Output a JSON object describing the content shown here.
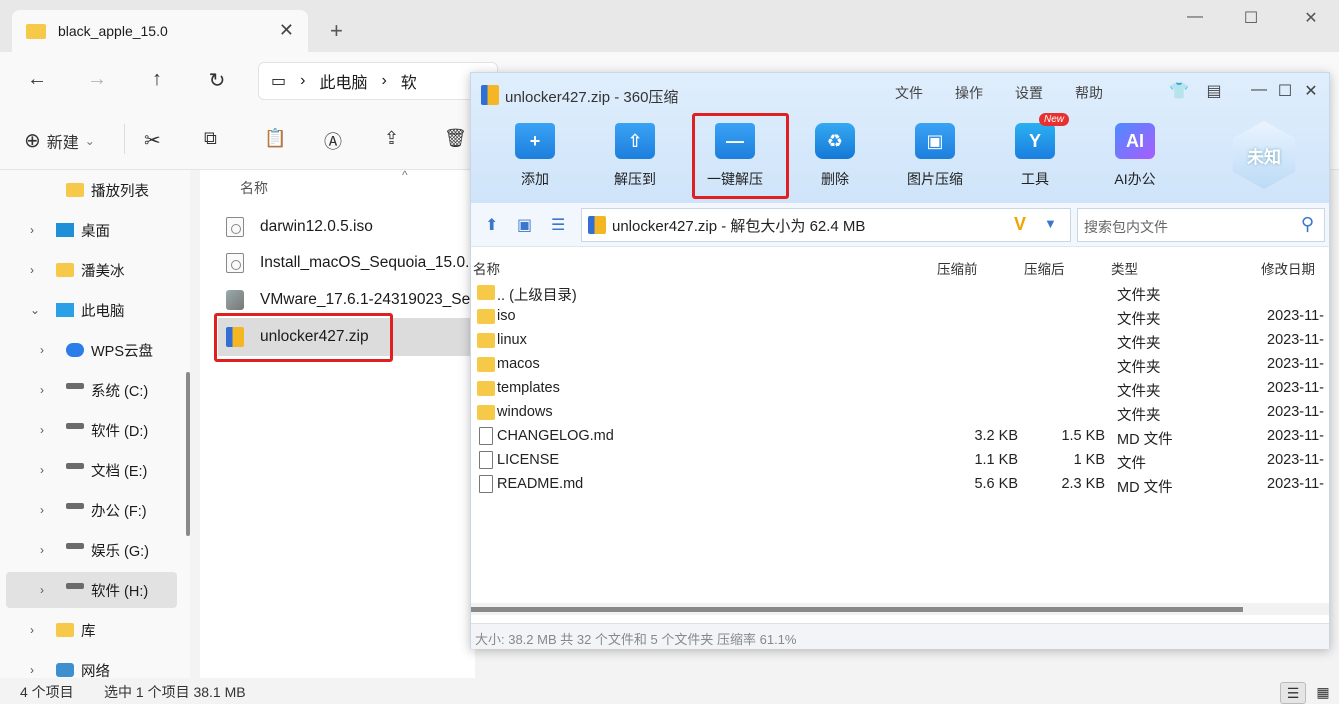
{
  "explorer": {
    "tab_title": "black_apple_15.0",
    "tab_close": "✕",
    "new_tab": "+",
    "window_controls": {
      "minimize": "—",
      "maximize": "☐",
      "close": "✕"
    },
    "nav": {
      "back": "←",
      "forward": "→",
      "up": "↑",
      "refresh": "↻"
    },
    "breadcrumb": [
      "此电脑",
      "软"
    ],
    "commandbar": {
      "new_label": "新建",
      "new_caret": "⌄"
    },
    "sidebar": [
      {
        "label": "播放列表",
        "kind": "folder",
        "chevron": ""
      },
      {
        "label": "桌面",
        "kind": "desktop",
        "chevron": "›"
      },
      {
        "label": "潘美冰",
        "kind": "folder",
        "chevron": "›"
      },
      {
        "label": "此电脑",
        "kind": "pc",
        "chevron": "⌄"
      },
      {
        "label": "WPS云盘",
        "kind": "cloud",
        "chevron": "›"
      },
      {
        "label": "系统 (C:)",
        "kind": "drive",
        "chevron": "›"
      },
      {
        "label": "软件 (D:)",
        "kind": "drive",
        "chevron": "›"
      },
      {
        "label": "文档 (E:)",
        "kind": "drive",
        "chevron": "›"
      },
      {
        "label": "办公 (F:)",
        "kind": "drive",
        "chevron": "›"
      },
      {
        "label": "娱乐 (G:)",
        "kind": "drive",
        "chevron": "›"
      },
      {
        "label": "软件 (H:)",
        "kind": "drive",
        "chevron": "›",
        "selected": true
      },
      {
        "label": "库",
        "kind": "folder",
        "chevron": "›"
      },
      {
        "label": "网络",
        "kind": "network",
        "chevron": "›"
      }
    ],
    "files_header": "名称",
    "sort_caret": "^",
    "files": [
      {
        "name": "darwin12.0.5.iso",
        "icon": "iso-file-icon"
      },
      {
        "name": "Install_macOS_Sequoia_15.0.iso",
        "icon": "iso-file-icon"
      },
      {
        "name": "VMware_17.6.1-24319023_Setup.exe",
        "icon": "vmware-installer-icon"
      },
      {
        "name": "unlocker427.zip",
        "icon": "zip-file-icon",
        "selected": true
      }
    ],
    "status": {
      "count": "4 个项目",
      "selected": "选中 1 个项目  38.1 MB"
    },
    "view_buttons": {
      "details": "☰",
      "tiles": "▦"
    }
  },
  "zip": {
    "title": "unlocker427.zip - 360压缩",
    "menu": [
      "文件",
      "操作",
      "设置",
      "帮助"
    ],
    "window_icons": {
      "skin": "👕",
      "feedback": "▤",
      "minimize": "—",
      "maximize": "☐",
      "close": "✕"
    },
    "toolbar": [
      {
        "label": "添加",
        "icon": "add-icon",
        "glyph": "+"
      },
      {
        "label": "解压到",
        "icon": "extract-to-icon",
        "glyph": "⇧"
      },
      {
        "label": "一键解压",
        "icon": "one-click-extract-icon",
        "glyph": "—"
      },
      {
        "label": "删除",
        "icon": "delete-icon",
        "glyph": "♻"
      },
      {
        "label": "图片压缩",
        "icon": "image-compress-icon",
        "glyph": "▣"
      },
      {
        "label": "工具",
        "icon": "tools-icon",
        "glyph": "Y",
        "badge": "New"
      },
      {
        "label": "AI办公",
        "icon": "ai-office-icon",
        "glyph": "AI"
      }
    ],
    "brand_badge": "未知",
    "address": "unlocker427.zip - 解包大小为 62.4 MB",
    "address_logo": "V",
    "search_placeholder": "搜索包内文件",
    "columns": {
      "name": "名称",
      "compressed": "压缩前",
      "after": "压缩后",
      "type": "类型",
      "modified": "修改日期"
    },
    "rows": [
      {
        "name": ".. (上级目录)",
        "before": "",
        "after": "",
        "type": "文件夹",
        "date": "",
        "kind": "folder"
      },
      {
        "name": "iso",
        "before": "",
        "after": "",
        "type": "文件夹",
        "date": "2023-11-",
        "kind": "folder"
      },
      {
        "name": "linux",
        "before": "",
        "after": "",
        "type": "文件夹",
        "date": "2023-11-",
        "kind": "folder"
      },
      {
        "name": "macos",
        "before": "",
        "after": "",
        "type": "文件夹",
        "date": "2023-11-",
        "kind": "folder"
      },
      {
        "name": "templates",
        "before": "",
        "after": "",
        "type": "文件夹",
        "date": "2023-11-",
        "kind": "folder"
      },
      {
        "name": "windows",
        "before": "",
        "after": "",
        "type": "文件夹",
        "date": "2023-11-",
        "kind": "folder"
      },
      {
        "name": "CHANGELOG.md",
        "before": "3.2 KB",
        "after": "1.5 KB",
        "type": "MD 文件",
        "date": "2023-11-",
        "kind": "file"
      },
      {
        "name": "LICENSE",
        "before": "1.1 KB",
        "after": "1 KB",
        "type": "文件",
        "date": "2023-11-",
        "kind": "file"
      },
      {
        "name": "README.md",
        "before": "5.6 KB",
        "after": "2.3 KB",
        "type": "MD 文件",
        "date": "2023-11-",
        "kind": "file"
      }
    ],
    "status": "大小: 38.2 MB 共 32 个文件和 5 个文件夹 压缩率 61.1%"
  },
  "colors": {
    "highlight_red": "#e02020",
    "zip_blue": "#1d7fdd",
    "folder_yellow": "#f7c948"
  }
}
